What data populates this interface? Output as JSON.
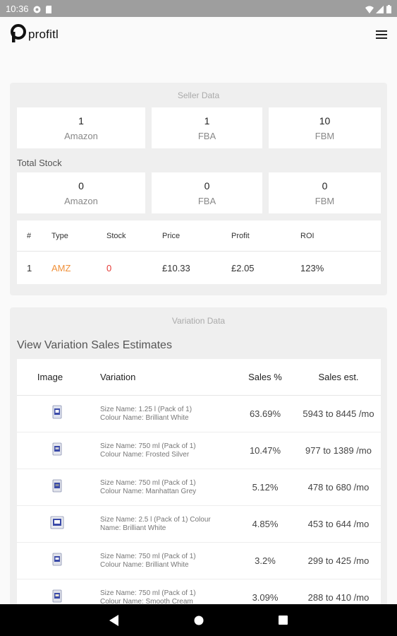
{
  "status_bar": {
    "time": "10:36"
  },
  "app": {
    "name": "profitl"
  },
  "seller_data": {
    "title": "Seller Data",
    "sellers": [
      {
        "value": "1",
        "label": "Amazon"
      },
      {
        "value": "1",
        "label": "FBA"
      },
      {
        "value": "10",
        "label": "FBM"
      }
    ],
    "total_stock_label": "Total Stock",
    "stock": [
      {
        "value": "0",
        "label": "Amazon"
      },
      {
        "value": "0",
        "label": "FBA"
      },
      {
        "value": "0",
        "label": "FBM"
      }
    ],
    "table": {
      "headers": [
        "#",
        "Type",
        "Stock",
        "Price",
        "Profit",
        "ROI"
      ],
      "rows": [
        {
          "num": "1",
          "type": "AMZ",
          "stock": "0",
          "price": "£10.33",
          "profit": "£2.05",
          "roi": "123%"
        }
      ]
    },
    "colors": {
      "type": "#f0913a",
      "stock": "#e53935"
    }
  },
  "variation_data": {
    "title": "Variation Data",
    "heading": "View Variation Sales Estimates",
    "headers": [
      "Image",
      "Variation",
      "Sales %",
      "Sales est."
    ],
    "rows": [
      {
        "line1": "Size Name: 1.25 l (Pack of 1)",
        "line2": "Colour Name: Brilliant White",
        "sales_pct": "63.69%",
        "sales_est": "5943 to 8445 /mo"
      },
      {
        "line1": "Size Name: 750 ml (Pack of 1)",
        "line2": "Colour Name: Frosted Silver",
        "sales_pct": "10.47%",
        "sales_est": "977 to 1389 /mo"
      },
      {
        "line1": "Size Name: 750 ml (Pack of 1)",
        "line2": "Colour Name: Manhattan Grey",
        "sales_pct": "5.12%",
        "sales_est": "478 to 680 /mo"
      },
      {
        "line1": "Size Name: 2.5 l (Pack of 1) Colour",
        "line2": "Name: Brilliant White",
        "sales_pct": "4.85%",
        "sales_est": "453 to 644 /mo"
      },
      {
        "line1": "Size Name: 750 ml (Pack of 1)",
        "line2": "Colour Name: Brilliant White",
        "sales_pct": "3.2%",
        "sales_est": "299 to 425 /mo"
      },
      {
        "line1": "Size Name: 750 ml (Pack of 1)",
        "line2": "Colour Name: Smooth Cream",
        "sales_pct": "3.09%",
        "sales_est": "288 to 410 /mo"
      }
    ]
  }
}
